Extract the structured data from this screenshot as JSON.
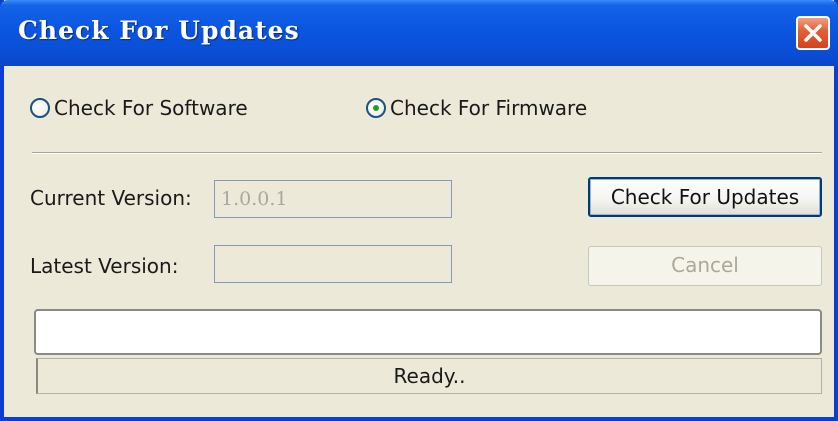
{
  "window": {
    "title": "Check For Updates"
  },
  "update_type": {
    "options": [
      {
        "label": "Check For Software",
        "selected": false
      },
      {
        "label": "Check For Firmware",
        "selected": true
      }
    ]
  },
  "fields": {
    "current_version_label": "Current Version:",
    "current_version_value": "1.0.0.1",
    "latest_version_label": "Latest Version:",
    "latest_version_value": ""
  },
  "buttons": {
    "check_label": "Check For Updates",
    "cancel_label": "Cancel"
  },
  "progress": {
    "fraction": 0
  },
  "status": {
    "text": "Ready.."
  },
  "icons": {
    "close": "close-icon"
  },
  "colors": {
    "title_bar": "#0a4ed6",
    "close_button": "#d4411c",
    "radio_dot": "#21a121",
    "dialog_background": "#ece9d8"
  }
}
